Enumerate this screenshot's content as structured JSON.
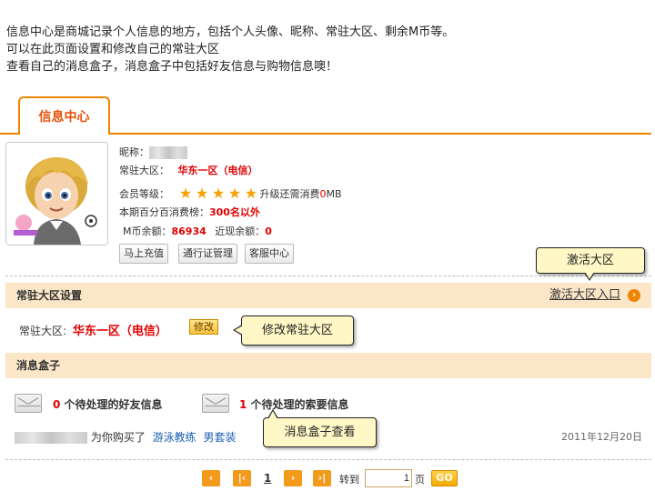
{
  "intro": {
    "line1": "信息中心是商城记录个人信息的地方，包括个人头像、昵称、常驻大区、剩余M币等。",
    "line2": "可以在此页面设置和修改自己的常驻大区",
    "line3": "查看自己的消息盒子，消息盒子中包括好友信息与购物信息噢！"
  },
  "tab": {
    "label": "信息中心"
  },
  "profile": {
    "nickname_label": "昵称：",
    "region_label": "常驻大区：",
    "region_value": "华东一区（电信）",
    "member_label": "会员等级：",
    "member_stars": 5,
    "upgrade_text_1": "升级还需消费",
    "upgrade_amount": "0",
    "upgrade_unit": "MB",
    "rank_label": "本期百分百消费榜：",
    "rank_value": "300名以外",
    "mcoin_label": "M币余额：",
    "mcoin_value": "86934",
    "recent_label": "近现余额：",
    "recent_value": "0"
  },
  "buttons": {
    "recharge": "马上充值",
    "pass_manage": "通行证管理",
    "service": "客服中心"
  },
  "region_section": {
    "title": "常驻大区设置",
    "activate_link": "激活大区入口",
    "current_label": "常驻大区:",
    "current_value": "华东一区（电信）",
    "modify_label": "修改"
  },
  "message_section": {
    "title": "消息盒子",
    "friend_count": "0",
    "friend_text": "个待处理的好友信息",
    "request_count": "1",
    "request_text": "个待处理的索要信息",
    "purchase_text": "为你购买了",
    "item1": "游泳教练",
    "item2": "男套装",
    "date": "2011年12月20日"
  },
  "callouts": {
    "activate": "激活大区",
    "modify": "修改常驻大区",
    "messages": "消息盒子查看"
  },
  "pagination": {
    "current_page": "1",
    "jump_label": "转到",
    "jump_value": "1",
    "page_unit": "页",
    "go_label": "GO"
  },
  "colors": {
    "accent": "#f08300",
    "highlight_red": "#e00000",
    "section_bg": "#fbe6c7",
    "callout_bg": "#fff8c6",
    "link_blue": "#1a5fb4"
  }
}
